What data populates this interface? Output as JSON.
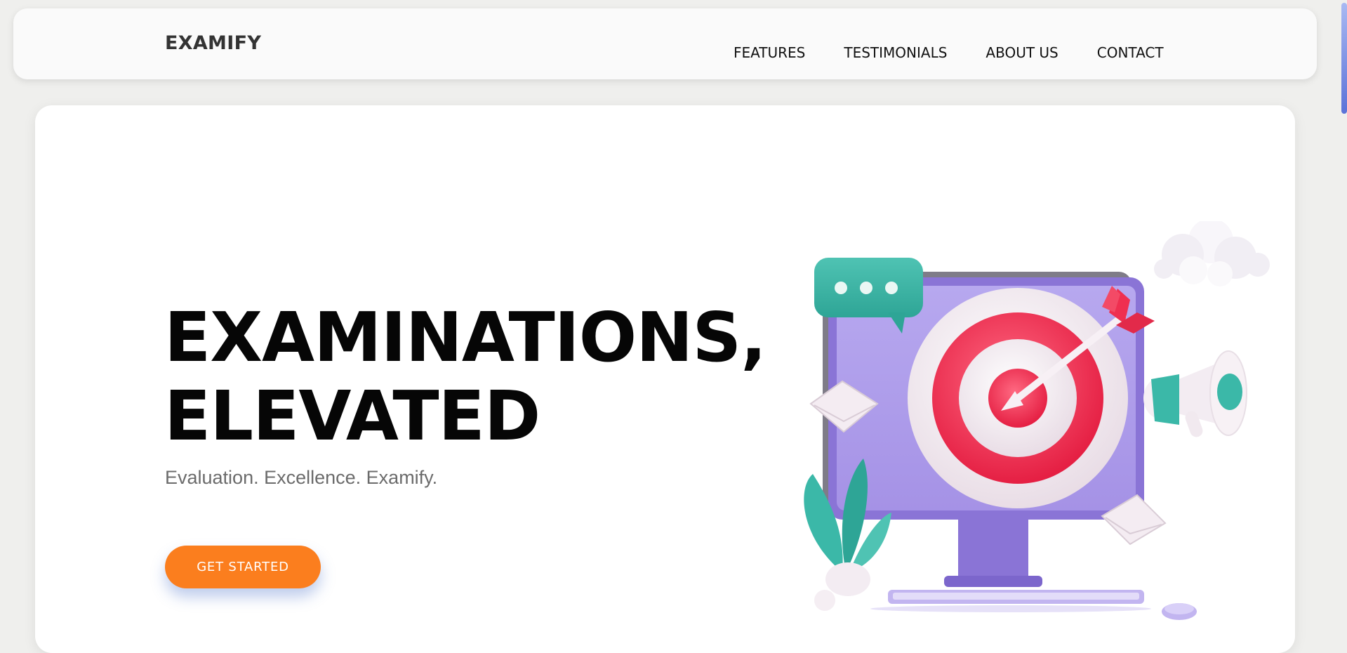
{
  "brand": "EXAMIFY",
  "nav": {
    "items": [
      {
        "label": "FEATURES"
      },
      {
        "label": "TESTIMONIALS"
      },
      {
        "label": "ABOUT US"
      },
      {
        "label": "CONTACT"
      }
    ]
  },
  "hero": {
    "headline_line1": "EXAMINATIONS,",
    "headline_line2": "ELEVATED",
    "tagline": "Evaluation. Excellence. Examify.",
    "cta_label": "GET STARTED",
    "illustration_icon": "target-arrow-monitor-illustration"
  },
  "colors": {
    "accent": "#fb7e1e",
    "target_red": "#ef2f50",
    "monitor_purple": "#9a86e0",
    "teal": "#3bb8a8"
  }
}
